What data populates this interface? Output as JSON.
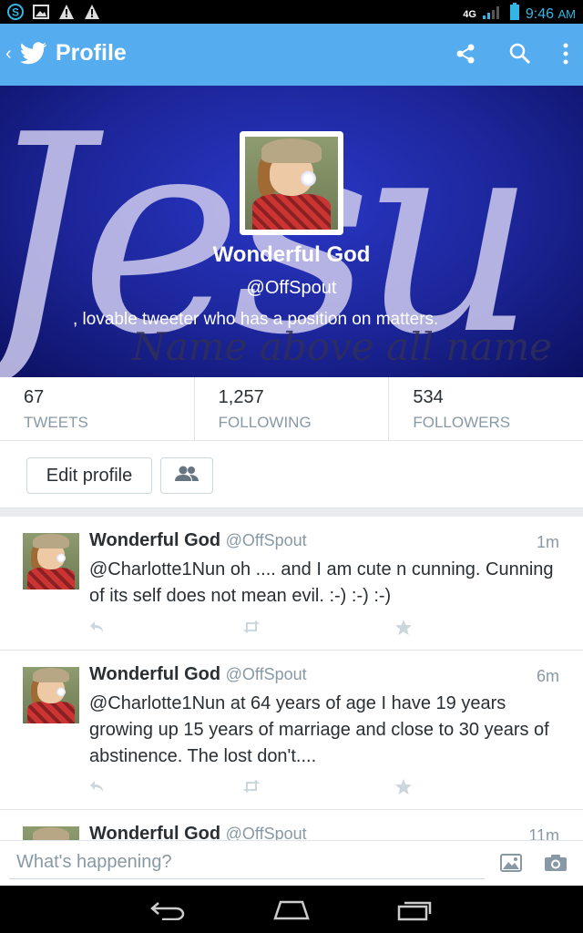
{
  "status_bar": {
    "network": "4G",
    "time": "9:46",
    "ampm": "AM"
  },
  "action_bar": {
    "title": "Profile"
  },
  "profile": {
    "banner_word": "Jesu",
    "banner_subtitle": "Name above all name",
    "name": "Wonderful  God",
    "handle": "@OffSpout",
    "bio": ",  lovable tweeter who has a position on matters."
  },
  "stats": [
    {
      "number": "67",
      "label": "TWEETS"
    },
    {
      "number": "1,257",
      "label": "FOLLOWING"
    },
    {
      "number": "534",
      "label": "FOLLOWERS"
    }
  ],
  "buttons": {
    "edit_profile": "Edit profile"
  },
  "tweets": [
    {
      "name": "Wonderful  God",
      "handle": "@OffSpout",
      "time": "1m",
      "text": "@Charlotte1Nun  oh .... and I am cute n cunning. Cunning of its self does not mean evil.  :-) :-) :-)"
    },
    {
      "name": "Wonderful  God",
      "handle": "@OffSpout",
      "time": "6m",
      "text": "@Charlotte1Nun  at 64 years of age I have 19 years growing up 15 years of marriage and close to 30 years of abstinence.  The lost don't...."
    },
    {
      "name": "Wonderful  God",
      "handle": "@OffSpout",
      "time": "11m",
      "text": ""
    }
  ],
  "compose": {
    "placeholder": "What's happening?"
  },
  "colors": {
    "twitter_blue": "#55acee",
    "banner_blue": "#1c2598",
    "text_dark": "#292f33",
    "text_gray": "#8899a6",
    "time_blue": "#33b5e5"
  },
  "icons": {
    "status_left": [
      "skype-icon",
      "gallery-icon",
      "warning-icon",
      "warning-icon"
    ],
    "action_bar": [
      "share-icon",
      "search-icon",
      "overflow-menu-icon"
    ],
    "tweet_actions": [
      "reply-icon",
      "retweet-icon",
      "favorite-icon"
    ],
    "compose": [
      "photo-icon",
      "camera-icon"
    ],
    "navigation": [
      "back-icon",
      "home-icon",
      "recent-apps-icon"
    ]
  }
}
